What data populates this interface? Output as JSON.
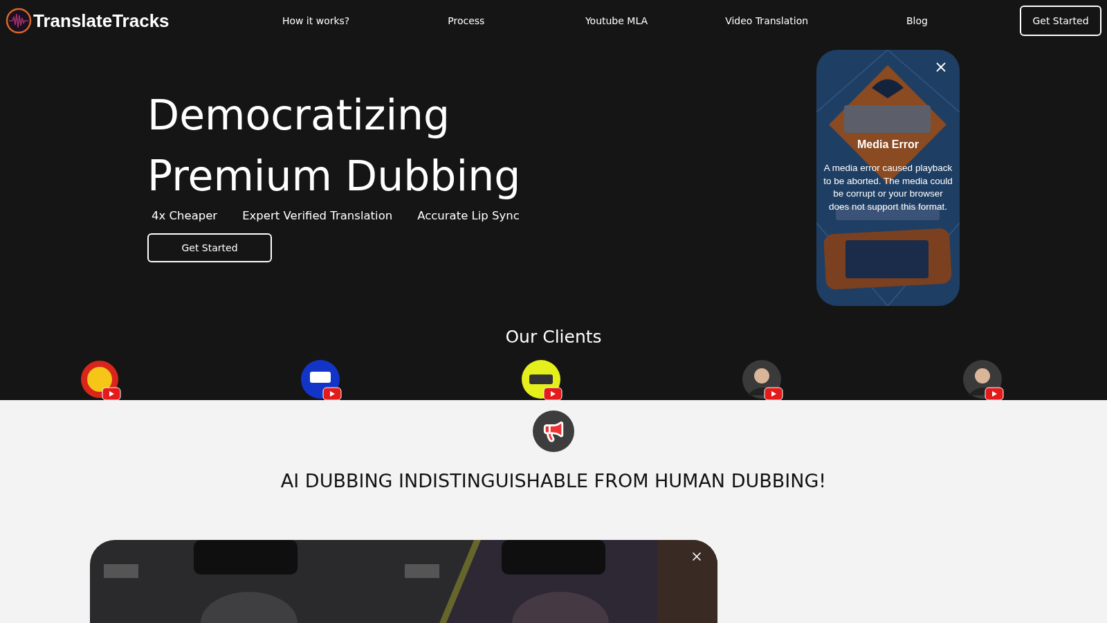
{
  "brand": {
    "name": "TranslateTracks"
  },
  "nav": {
    "links": [
      "How it works?",
      "Process",
      "Youtube MLA",
      "Video Translation",
      "Blog"
    ],
    "cta": "Get Started"
  },
  "hero": {
    "title_lines": [
      "Democratizing",
      "Premium Dubbing"
    ],
    "features": [
      "4x Cheaper",
      "Expert Verified Translation",
      "Accurate Lip Sync"
    ],
    "cta": "Get Started"
  },
  "promo_video": {
    "kind": "picture",
    "error_title": "Media Error",
    "error_message": "A media error caused playback to be aborted. The media could be corrupt or your browser does not support this format."
  },
  "clients": {
    "title": "Our Clients",
    "items": [
      {
        "kind": "seal"
      },
      {
        "kind": "wordmark"
      },
      {
        "kind": "tag"
      },
      {
        "kind": "person"
      },
      {
        "kind": "person"
      }
    ]
  },
  "feature": {
    "heading": "AI DUBBING INDISTINGUISHABLE FROM HUMAN DUBBING!"
  }
}
